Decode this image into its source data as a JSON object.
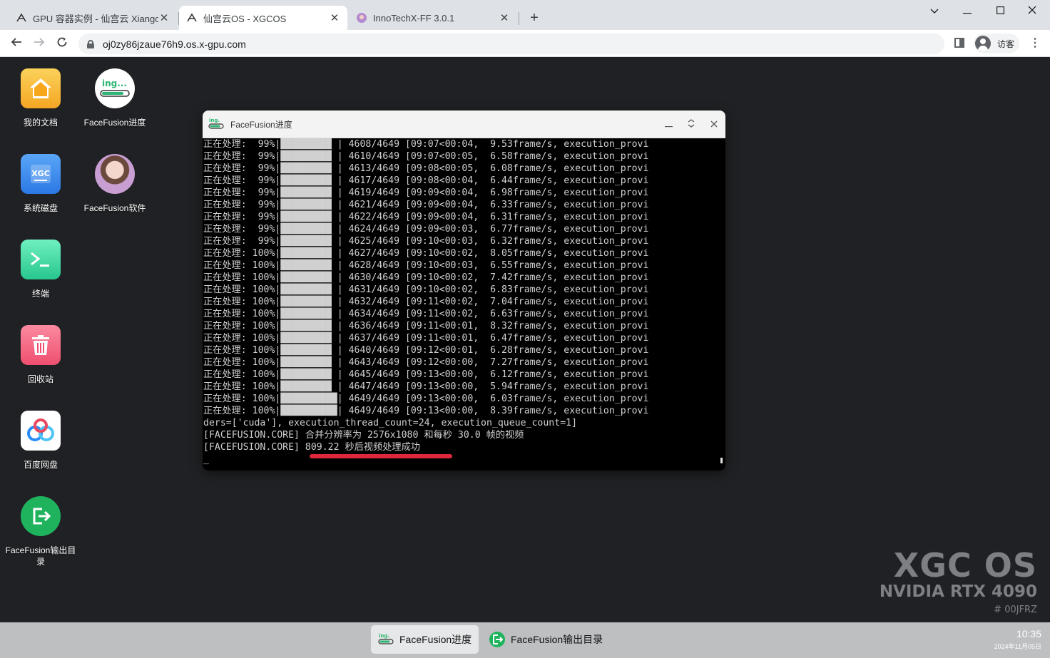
{
  "browser": {
    "tabs": [
      {
        "title": "GPU 容器实例 - 仙宫云 Xiangong",
        "favicon": "xgc-logo-icon",
        "active": false
      },
      {
        "title": "仙宫云OS - XGCOS",
        "favicon": "xgc-logo-icon",
        "active": true
      },
      {
        "title": "InnoTechX-FF 3.0.1",
        "favicon": "avatar-icon",
        "active": false
      }
    ],
    "url": "oj0zy86jzaue76h9.os.x-gpu.com",
    "profile_label": "访客",
    "window_controls": [
      "chevron-down-icon",
      "minimize-icon",
      "maximize-icon",
      "close-icon"
    ]
  },
  "desktop": {
    "icons": [
      {
        "label": "我的文档",
        "icon": "home-folder-icon",
        "color": "#f7a71c"
      },
      {
        "label": "FaceFusion进度",
        "icon": "progress-icon",
        "color": "#ffffff"
      },
      {
        "label": "系统磁盘",
        "icon": "disk-icon",
        "color": "#3d8ef0"
      },
      {
        "label": "FaceFusion软件",
        "icon": "face-avatar-icon",
        "color": "#c99fd3"
      },
      {
        "label": "终端",
        "icon": "terminal-icon",
        "color": "#2bd197"
      },
      {
        "label": "回收站",
        "icon": "trash-icon",
        "color": "#f05c78"
      },
      {
        "label": "百度网盘",
        "icon": "baidu-netdisk-icon",
        "color": "#2a8cf7"
      },
      {
        "label": "FaceFusion输出目录",
        "icon": "export-icon",
        "color": "#1fb35e"
      }
    ],
    "watermark": {
      "os": "XGC OS",
      "gpu": "NVIDIA RTX 4090",
      "id": "# 00JFRZ"
    }
  },
  "window": {
    "title": "FaceFusion进度",
    "terminal_lines": [
      "正在处理:  99%|█████████ | 4608/4649 [09:07<00:04,  9.53frame/s, execution_provi",
      "正在处理:  99%|█████████ | 4610/4649 [09:07<00:05,  6.58frame/s, execution_provi",
      "正在处理:  99%|█████████ | 4613/4649 [09:08<00:05,  6.08frame/s, execution_provi",
      "正在处理:  99%|█████████ | 4617/4649 [09:08<00:04,  6.44frame/s, execution_provi",
      "正在处理:  99%|█████████ | 4619/4649 [09:09<00:04,  6.98frame/s, execution_provi",
      "正在处理:  99%|█████████ | 4621/4649 [09:09<00:04,  6.33frame/s, execution_provi",
      "正在处理:  99%|█████████ | 4622/4649 [09:09<00:04,  6.31frame/s, execution_provi",
      "正在处理:  99%|█████████ | 4624/4649 [09:09<00:03,  6.77frame/s, execution_provi",
      "正在处理:  99%|█████████ | 4625/4649 [09:10<00:03,  6.32frame/s, execution_provi",
      "正在处理: 100%|█████████ | 4627/4649 [09:10<00:02,  8.05frame/s, execution_provi",
      "正在处理: 100%|█████████ | 4628/4649 [09:10<00:03,  6.55frame/s, execution_provi",
      "正在处理: 100%|█████████ | 4630/4649 [09:10<00:02,  7.42frame/s, execution_provi",
      "正在处理: 100%|█████████ | 4631/4649 [09:10<00:02,  6.83frame/s, execution_provi",
      "正在处理: 100%|█████████ | 4632/4649 [09:11<00:02,  7.04frame/s, execution_provi",
      "正在处理: 100%|█████████ | 4634/4649 [09:11<00:02,  6.63frame/s, execution_provi",
      "正在处理: 100%|█████████ | 4636/4649 [09:11<00:01,  8.32frame/s, execution_provi",
      "正在处理: 100%|█████████ | 4637/4649 [09:11<00:01,  6.47frame/s, execution_provi",
      "正在处理: 100%|█████████ | 4640/4649 [09:12<00:01,  6.28frame/s, execution_provi",
      "正在处理: 100%|█████████ | 4643/4649 [09:12<00:00,  7.27frame/s, execution_provi",
      "正在处理: 100%|█████████ | 4645/4649 [09:13<00:00,  6.12frame/s, execution_provi",
      "正在处理: 100%|█████████ | 4647/4649 [09:13<00:00,  5.94frame/s, execution_provi",
      "正在处理: 100%|██████████| 4649/4649 [09:13<00:00,  6.03frame/s, execution_provi",
      "正在处理: 100%|██████████| 4649/4649 [09:13<00:00,  8.39frame/s, execution_provi",
      "ders=['cuda'], execution_thread_count=24, execution_queue_count=1]",
      "[FACEFUSION.CORE] 合并分辨率为 2576x1080 和每秒 30.0 帧的视频",
      "[FACEFUSION.CORE] 809.22 秒后视频处理成功"
    ],
    "cursor": "_",
    "highlight_color": "#e0283c"
  },
  "taskbar": {
    "items": [
      {
        "label": "FaceFusion进度",
        "icon": "progress-icon",
        "active": true
      },
      {
        "label": "FaceFusion输出目录",
        "icon": "export-icon",
        "active": false
      }
    ],
    "time": "10:35",
    "date": "2024年11月05日"
  }
}
